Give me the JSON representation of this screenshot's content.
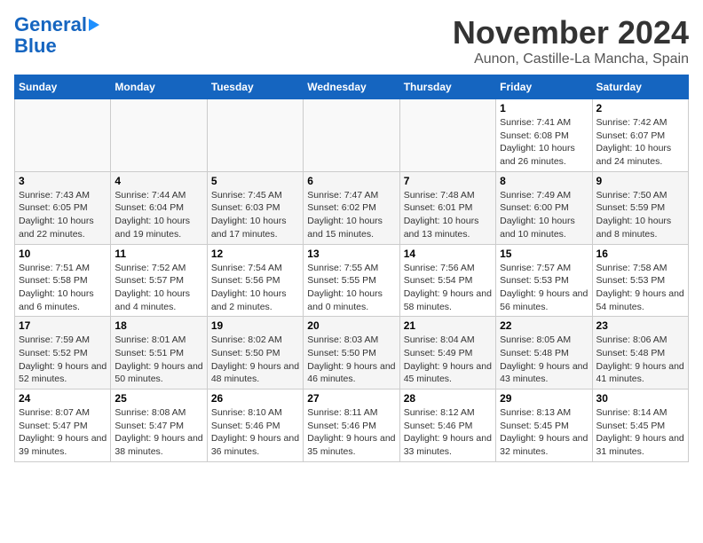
{
  "header": {
    "logo_line1": "General",
    "logo_line2": "Blue",
    "title": "November 2024",
    "subtitle": "Aunon, Castille-La Mancha, Spain"
  },
  "calendar": {
    "days_of_week": [
      "Sunday",
      "Monday",
      "Tuesday",
      "Wednesday",
      "Thursday",
      "Friday",
      "Saturday"
    ],
    "weeks": [
      [
        {
          "day": "",
          "info": ""
        },
        {
          "day": "",
          "info": ""
        },
        {
          "day": "",
          "info": ""
        },
        {
          "day": "",
          "info": ""
        },
        {
          "day": "",
          "info": ""
        },
        {
          "day": "1",
          "info": "Sunrise: 7:41 AM\nSunset: 6:08 PM\nDaylight: 10 hours and 26 minutes."
        },
        {
          "day": "2",
          "info": "Sunrise: 7:42 AM\nSunset: 6:07 PM\nDaylight: 10 hours and 24 minutes."
        }
      ],
      [
        {
          "day": "3",
          "info": "Sunrise: 7:43 AM\nSunset: 6:05 PM\nDaylight: 10 hours and 22 minutes."
        },
        {
          "day": "4",
          "info": "Sunrise: 7:44 AM\nSunset: 6:04 PM\nDaylight: 10 hours and 19 minutes."
        },
        {
          "day": "5",
          "info": "Sunrise: 7:45 AM\nSunset: 6:03 PM\nDaylight: 10 hours and 17 minutes."
        },
        {
          "day": "6",
          "info": "Sunrise: 7:47 AM\nSunset: 6:02 PM\nDaylight: 10 hours and 15 minutes."
        },
        {
          "day": "7",
          "info": "Sunrise: 7:48 AM\nSunset: 6:01 PM\nDaylight: 10 hours and 13 minutes."
        },
        {
          "day": "8",
          "info": "Sunrise: 7:49 AM\nSunset: 6:00 PM\nDaylight: 10 hours and 10 minutes."
        },
        {
          "day": "9",
          "info": "Sunrise: 7:50 AM\nSunset: 5:59 PM\nDaylight: 10 hours and 8 minutes."
        }
      ],
      [
        {
          "day": "10",
          "info": "Sunrise: 7:51 AM\nSunset: 5:58 PM\nDaylight: 10 hours and 6 minutes."
        },
        {
          "day": "11",
          "info": "Sunrise: 7:52 AM\nSunset: 5:57 PM\nDaylight: 10 hours and 4 minutes."
        },
        {
          "day": "12",
          "info": "Sunrise: 7:54 AM\nSunset: 5:56 PM\nDaylight: 10 hours and 2 minutes."
        },
        {
          "day": "13",
          "info": "Sunrise: 7:55 AM\nSunset: 5:55 PM\nDaylight: 10 hours and 0 minutes."
        },
        {
          "day": "14",
          "info": "Sunrise: 7:56 AM\nSunset: 5:54 PM\nDaylight: 9 hours and 58 minutes."
        },
        {
          "day": "15",
          "info": "Sunrise: 7:57 AM\nSunset: 5:53 PM\nDaylight: 9 hours and 56 minutes."
        },
        {
          "day": "16",
          "info": "Sunrise: 7:58 AM\nSunset: 5:53 PM\nDaylight: 9 hours and 54 minutes."
        }
      ],
      [
        {
          "day": "17",
          "info": "Sunrise: 7:59 AM\nSunset: 5:52 PM\nDaylight: 9 hours and 52 minutes."
        },
        {
          "day": "18",
          "info": "Sunrise: 8:01 AM\nSunset: 5:51 PM\nDaylight: 9 hours and 50 minutes."
        },
        {
          "day": "19",
          "info": "Sunrise: 8:02 AM\nSunset: 5:50 PM\nDaylight: 9 hours and 48 minutes."
        },
        {
          "day": "20",
          "info": "Sunrise: 8:03 AM\nSunset: 5:50 PM\nDaylight: 9 hours and 46 minutes."
        },
        {
          "day": "21",
          "info": "Sunrise: 8:04 AM\nSunset: 5:49 PM\nDaylight: 9 hours and 45 minutes."
        },
        {
          "day": "22",
          "info": "Sunrise: 8:05 AM\nSunset: 5:48 PM\nDaylight: 9 hours and 43 minutes."
        },
        {
          "day": "23",
          "info": "Sunrise: 8:06 AM\nSunset: 5:48 PM\nDaylight: 9 hours and 41 minutes."
        }
      ],
      [
        {
          "day": "24",
          "info": "Sunrise: 8:07 AM\nSunset: 5:47 PM\nDaylight: 9 hours and 39 minutes."
        },
        {
          "day": "25",
          "info": "Sunrise: 8:08 AM\nSunset: 5:47 PM\nDaylight: 9 hours and 38 minutes."
        },
        {
          "day": "26",
          "info": "Sunrise: 8:10 AM\nSunset: 5:46 PM\nDaylight: 9 hours and 36 minutes."
        },
        {
          "day": "27",
          "info": "Sunrise: 8:11 AM\nSunset: 5:46 PM\nDaylight: 9 hours and 35 minutes."
        },
        {
          "day": "28",
          "info": "Sunrise: 8:12 AM\nSunset: 5:46 PM\nDaylight: 9 hours and 33 minutes."
        },
        {
          "day": "29",
          "info": "Sunrise: 8:13 AM\nSunset: 5:45 PM\nDaylight: 9 hours and 32 minutes."
        },
        {
          "day": "30",
          "info": "Sunrise: 8:14 AM\nSunset: 5:45 PM\nDaylight: 9 hours and 31 minutes."
        }
      ]
    ]
  }
}
